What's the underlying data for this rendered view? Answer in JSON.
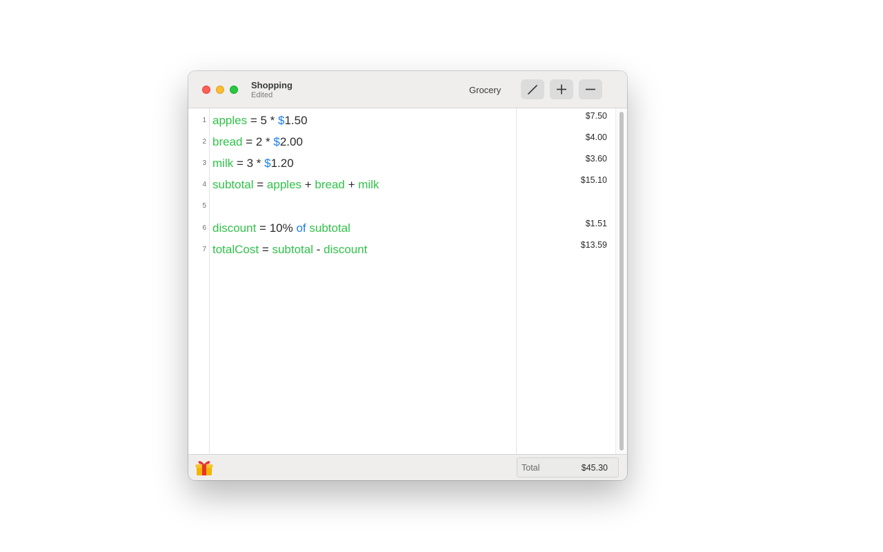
{
  "window": {
    "title": "Shopping",
    "subtitle": "Edited",
    "category": "Grocery"
  },
  "toolbar": {
    "edit_icon": "pencil-icon",
    "add_icon": "plus-icon",
    "remove_icon": "minus-icon"
  },
  "lines": [
    {
      "number": "1",
      "result": "$7.50"
    },
    {
      "number": "2",
      "result": "$4.00"
    },
    {
      "number": "3",
      "result": "$3.60"
    },
    {
      "number": "4",
      "result": "$15.10"
    },
    {
      "number": "5",
      "result": ""
    },
    {
      "number": "6",
      "result": "$1.51"
    },
    {
      "number": "7",
      "result": "$13.59"
    }
  ],
  "code": {
    "l1": {
      "var": "apples",
      "op1": " = 5 * ",
      "cur": "$",
      "num": "1.50"
    },
    "l2": {
      "var": "bread",
      "op1": " = 2 * ",
      "cur": "$",
      "num": "2.00"
    },
    "l3": {
      "var": "milk",
      "op1": " = 3 * ",
      "cur": "$",
      "num": "1.20"
    },
    "l4": {
      "var": "subtotal",
      "eq": " = ",
      "a": "apples",
      "p1": " + ",
      "b": "bread",
      "p2": " + ",
      "c": "milk"
    },
    "l6": {
      "var": "discount",
      "eq": " = 10% ",
      "kw": "of",
      "sp": " ",
      "ref": "subtotal"
    },
    "l7": {
      "var": "totalCost",
      "eq": " = ",
      "a": "subtotal",
      "minus": " - ",
      "b": "discount"
    }
  },
  "footer": {
    "total_label": "Total",
    "total_value": "$45.30",
    "gift_icon": "gift-icon"
  },
  "colors": {
    "variable": "#30c24a",
    "keyword": "#1a7ee8",
    "text": "#2a2a2a"
  }
}
